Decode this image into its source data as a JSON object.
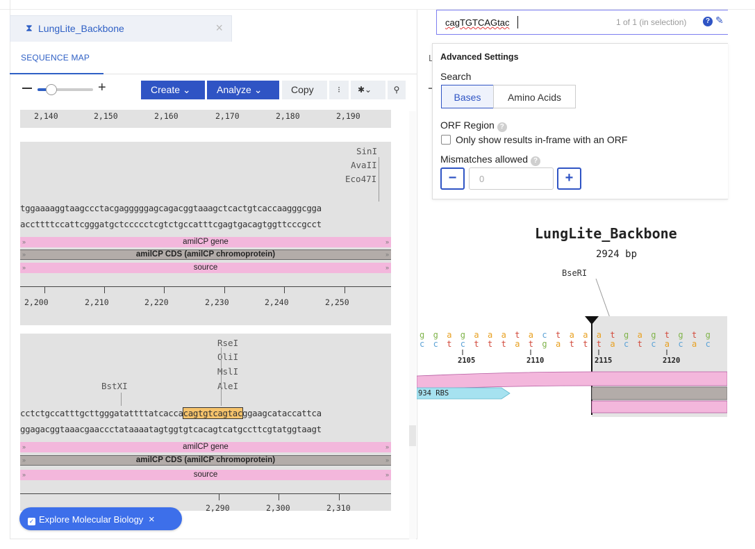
{
  "doc_tab": {
    "title": "LungLite_Backbone",
    "icon": "hourglass-icon",
    "close": "×"
  },
  "view_tab": {
    "label": "SEQUENCE MAP"
  },
  "toolbar": {
    "zoom_plus": "+",
    "create": "Create ⌄",
    "analyze": "Analyze ⌄",
    "copy": "Copy",
    "more": "⁝",
    "gear": "✱⌄",
    "search": "⚲"
  },
  "block0": {
    "ruler": [
      "2,140",
      "2,150",
      "2,160",
      "2,170",
      "2,180",
      "2,190"
    ]
  },
  "block1": {
    "enzymes": [
      "SinI",
      "AvaII",
      "Eco47I"
    ],
    "seq_top": "tggaaaaggtaagccctacgagggggagcagacggtaaagctcactgtcaccaagggcgga",
    "seq_bottom": "accttttccattcgggatgctccccctcgtctgccatttcgagtgacagtggttcccgcct",
    "features": [
      "amilCP gene",
      "amilCP CDS (amilCP chromoprotein)",
      "source"
    ],
    "ruler": [
      "2,200",
      "2,210",
      "2,220",
      "2,230",
      "2,240",
      "2,250"
    ]
  },
  "block2": {
    "enzymes_right": [
      "RseI",
      "OliI",
      "MslI",
      "AleI"
    ],
    "enzyme_left": "BstXI",
    "seq_top_a": "cctctgccatttgcttgggatattttatcacca",
    "seq_top_hl": "cagtgtcagtac",
    "seq_top_b": "ggaagcataccattca",
    "seq_bottom": "ggagacggtaaacgaaccctataaaatagtggtgtcacagtcatgccttcgtatggtaagt",
    "features": [
      "amilCP gene",
      "amilCP CDS (amilCP chromoprotein)",
      "source"
    ],
    "ruler": [
      "2,290",
      "2,300",
      "2,310"
    ]
  },
  "explore": {
    "label": "Explore Molecular Biology",
    "close": "×"
  },
  "search": {
    "value": "cagTGTCAGtac",
    "count": "1 of 1 (in selection)"
  },
  "advanced": {
    "title": "Advanced Settings",
    "search_label": "Search",
    "bases": "Bases",
    "amino_acids": "Amino Acids",
    "orf_label": "ORF Region",
    "orf_checkbox": "Only show results in-frame with an ORF",
    "mismatch_label": "Mismatches allowed",
    "mismatch_value": "0",
    "minus": "−",
    "plus": "+"
  },
  "map": {
    "title": "LungLite_Backbone",
    "length": "2924 bp",
    "enzyme": "BseRI",
    "top_bases": [
      "g",
      "g",
      "a",
      "g",
      "a",
      "a",
      "a",
      "t",
      "a",
      "c",
      "t",
      "a",
      "a",
      "a",
      "t",
      "g",
      "a",
      "g",
      "t",
      "g",
      "t",
      "g"
    ],
    "bottom_bases": [
      "c",
      "c",
      "t",
      "c",
      "t",
      "t",
      "t",
      "a",
      "t",
      "g",
      "a",
      "t",
      "t",
      "t",
      "a",
      "c",
      "t",
      "c",
      "a",
      "c",
      "a",
      "c"
    ],
    "numbers": [
      "2105",
      "2110",
      "2115",
      "2120"
    ],
    "rbs_label": "934 RBS"
  },
  "right_tab_letter": "L",
  "colors": {
    "accent": "#2f54c4",
    "pink": "#f3b7dc",
    "gray_feature": "#b3aca9",
    "highlight": "#f6c36b",
    "rbs": "#a6e2f0"
  }
}
